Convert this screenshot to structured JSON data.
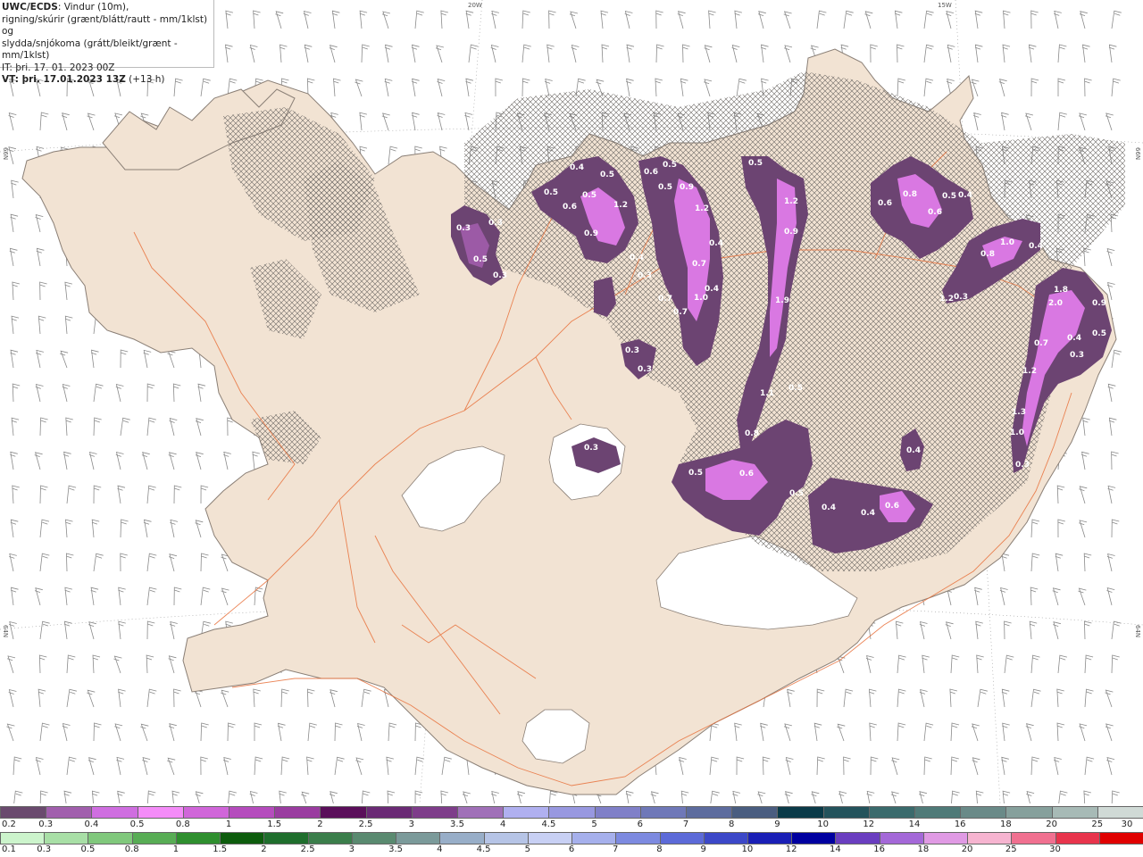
{
  "header": {
    "product": "UWC/ECDS",
    "line1_rest": ": Vindur (10m),",
    "line2": "rigning/skúrir (grænt/blátt/rautt - mm/1klst) og",
    "line3": "slydda/snjókoma (grátt/bleikt/grænt - mm/1klst)",
    "line4": "IT: þri. 17. 01. 2023 00Z",
    "vt_label": "VT: þri. 17.01.2023 13Z",
    "vt_offset": " (+13 h)"
  },
  "grid_labels": {
    "top_20w": "20W",
    "top_15w": "15W",
    "left_66n": "66N",
    "left_64n": "64N",
    "right_66n": "66N",
    "right_64n": "64N"
  },
  "colors": {
    "land": "#f2e3d3",
    "coast": "#8a7f76",
    "roads": "#e8703a",
    "sea": "#ffffff",
    "precip_light": "#6c4472",
    "precip_mid": "#9c5aa6",
    "precip_high": "#d978e2",
    "precip_peak": "#f08cf8"
  },
  "precip_labels": [
    {
      "v": "0.3",
      "k": "l1"
    },
    {
      "v": "0.3",
      "k": "l2"
    },
    {
      "v": "0.5",
      "k": "l3"
    },
    {
      "v": "0.3",
      "k": "l4"
    },
    {
      "v": "0.4",
      "k": "l5"
    },
    {
      "v": "0.5",
      "k": "l6"
    },
    {
      "v": "0.5",
      "k": "l7"
    },
    {
      "v": "0.6",
      "k": "l8"
    },
    {
      "v": "0.5",
      "k": "l9"
    },
    {
      "v": "0.9",
      "k": "l10"
    },
    {
      "v": "1.2",
      "k": "l11"
    },
    {
      "v": "0.6",
      "k": "l12"
    },
    {
      "v": "0.5",
      "k": "l13"
    },
    {
      "v": "0.5",
      "k": "l14"
    },
    {
      "v": "0.9",
      "k": "l15"
    },
    {
      "v": "1.2",
      "k": "l16"
    },
    {
      "v": "0.4",
      "k": "l17"
    },
    {
      "v": "0.3",
      "k": "l18"
    },
    {
      "v": "0.7",
      "k": "l19"
    },
    {
      "v": "0.4",
      "k": "l20"
    },
    {
      "v": "0.7",
      "k": "l21"
    },
    {
      "v": "0.7",
      "k": "l22"
    },
    {
      "v": "0.4",
      "k": "l23"
    },
    {
      "v": "1.0",
      "k": "l24"
    },
    {
      "v": "0.3",
      "k": "l25"
    },
    {
      "v": "0.3",
      "k": "l26"
    },
    {
      "v": "0.5",
      "k": "l27"
    },
    {
      "v": "1.2",
      "k": "l28"
    },
    {
      "v": "0.9",
      "k": "l29"
    },
    {
      "v": "1.9",
      "k": "l30"
    },
    {
      "v": "1.1",
      "k": "l31"
    },
    {
      "v": "0.5",
      "k": "l32"
    },
    {
      "v": "0.8",
      "k": "l33"
    },
    {
      "v": "0.5",
      "k": "l34"
    },
    {
      "v": "0.6",
      "k": "l35"
    },
    {
      "v": "0.5",
      "k": "l36"
    },
    {
      "v": "0.4",
      "k": "l37"
    },
    {
      "v": "0.4",
      "k": "l38"
    },
    {
      "v": "0.6",
      "k": "l39"
    },
    {
      "v": "0.4",
      "k": "l40"
    },
    {
      "v": "0.3",
      "k": "l41"
    },
    {
      "v": "0.6",
      "k": "l42"
    },
    {
      "v": "0.8",
      "k": "l43"
    },
    {
      "v": "0.6",
      "k": "l44"
    },
    {
      "v": "0.5",
      "k": "l45"
    },
    {
      "v": "0.4",
      "k": "l46"
    },
    {
      "v": "1.0",
      "k": "l47"
    },
    {
      "v": "0.8",
      "k": "l48"
    },
    {
      "v": "0.4",
      "k": "l49"
    },
    {
      "v": "1.2",
      "k": "l50"
    },
    {
      "v": "0.3",
      "k": "l51"
    },
    {
      "v": "1.8",
      "k": "l52"
    },
    {
      "v": "2.0",
      "k": "l53"
    },
    {
      "v": "0.9",
      "k": "l54"
    },
    {
      "v": "0.7",
      "k": "l55"
    },
    {
      "v": "0.4",
      "k": "l56"
    },
    {
      "v": "0.5",
      "k": "l57"
    },
    {
      "v": "0.3",
      "k": "l58"
    },
    {
      "v": "1.2",
      "k": "l59"
    },
    {
      "v": "1.3",
      "k": "l60"
    },
    {
      "v": "1.0",
      "k": "l61"
    },
    {
      "v": "0.3",
      "k": "l62"
    }
  ],
  "legend_snow": {
    "labels": [
      "0.2",
      "0.3",
      "0.4",
      "0.5",
      "0.8",
      "1",
      "1.5",
      "2",
      "2.5",
      "3",
      "3.5",
      "4",
      "4.5",
      "5",
      "6",
      "7",
      "8",
      "9",
      "10",
      "12",
      "14",
      "16",
      "18",
      "20",
      "25",
      "30"
    ],
    "colors": [
      "#6a4a6e",
      "#a15fad",
      "#cf6ee0",
      "#f48cf8",
      "#d066d9",
      "#b54cbd",
      "#9a3ca0",
      "#5a0f5a",
      "#6a2a75",
      "#7e3d8a",
      "#a070b8",
      "#b0b0f0",
      "#9898e0",
      "#8080c8",
      "#6f78b8",
      "#5d6c9e",
      "#4a5d80",
      "#0a3a48",
      "#24535c",
      "#3a6a6c",
      "#4f7a78",
      "#6a8a88",
      "#86a09c",
      "#a7bab6",
      "#d0dad6"
    ]
  },
  "legend_rain": {
    "labels": [
      "0.1",
      "0.3",
      "0.5",
      "0.8",
      "1",
      "1.5",
      "2",
      "2.5",
      "3",
      "3.5",
      "4",
      "4.5",
      "5",
      "6",
      "7",
      "8",
      "9",
      "10",
      "12",
      "14",
      "16",
      "18",
      "20",
      "25",
      "30"
    ],
    "colors": [
      "#ccf4cc",
      "#a8dfa6",
      "#80c87c",
      "#58ad55",
      "#2f8f2f",
      "#0d5c0d",
      "#1f6e2d",
      "#3b7e4b",
      "#5a8a70",
      "#7b9a9a",
      "#98aec8",
      "#b6c4e6",
      "#c8d0f4",
      "#a6b0ec",
      "#7d8ae0",
      "#5c6ad8",
      "#3c48c8",
      "#1a1fb6",
      "#0000a0",
      "#6a3ec0",
      "#a468d8",
      "#e09ae4",
      "#f6b4d0",
      "#f07090",
      "#e8344c",
      "#e00000"
    ]
  }
}
